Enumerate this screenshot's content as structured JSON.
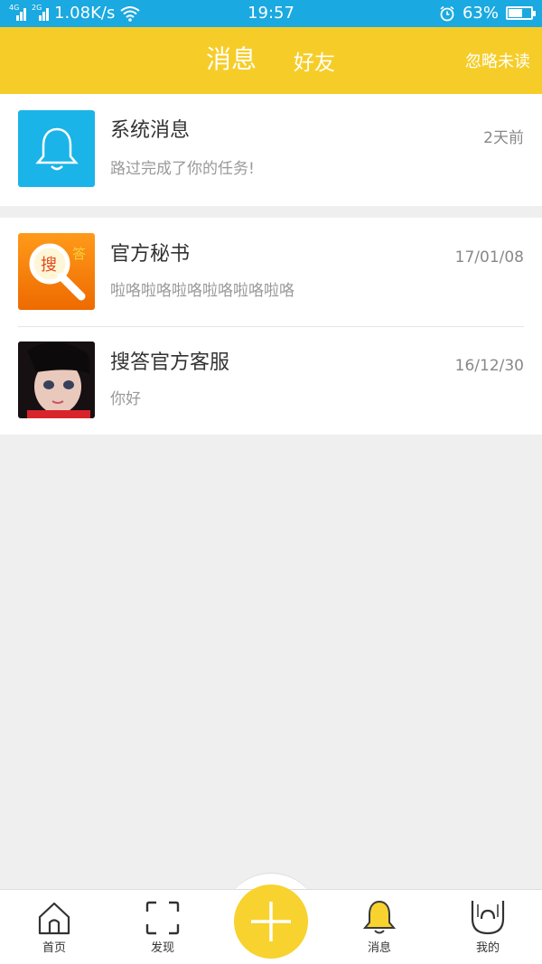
{
  "status_bar": {
    "net1": "4G",
    "net2": "2G",
    "speed": "1.08K/s",
    "time": "19:57",
    "battery": "63%",
    "battery_level": 0.63,
    "icons": [
      "signal-icon",
      "wifi-icon",
      "alarm-icon",
      "battery-icon"
    ]
  },
  "header": {
    "tab_messages": "消息",
    "tab_friends": "好友",
    "ignore_unread": "忽略未读",
    "bg_color": "#f6cd28"
  },
  "messages": [
    {
      "title": "系统消息",
      "preview": "路过完成了你的任务!",
      "time": "2天前",
      "icon": "bell-icon"
    },
    {
      "title": "官方秘书",
      "preview": "啦咯啦咯啦咯啦咯啦咯啦咯",
      "time": "17/01/08",
      "logo_text": "搜答"
    },
    {
      "title": "搜答官方客服",
      "preview": "你好",
      "time": "16/12/30",
      "icon": "user-avatar"
    }
  ],
  "bottom_nav": {
    "home": "首页",
    "discover": "发现",
    "messages": "消息",
    "mine": "我的",
    "icons": [
      "home-icon",
      "scan-icon",
      "plus-icon",
      "bell-icon",
      "profile-icon"
    ],
    "accent": "#f8d22e"
  }
}
